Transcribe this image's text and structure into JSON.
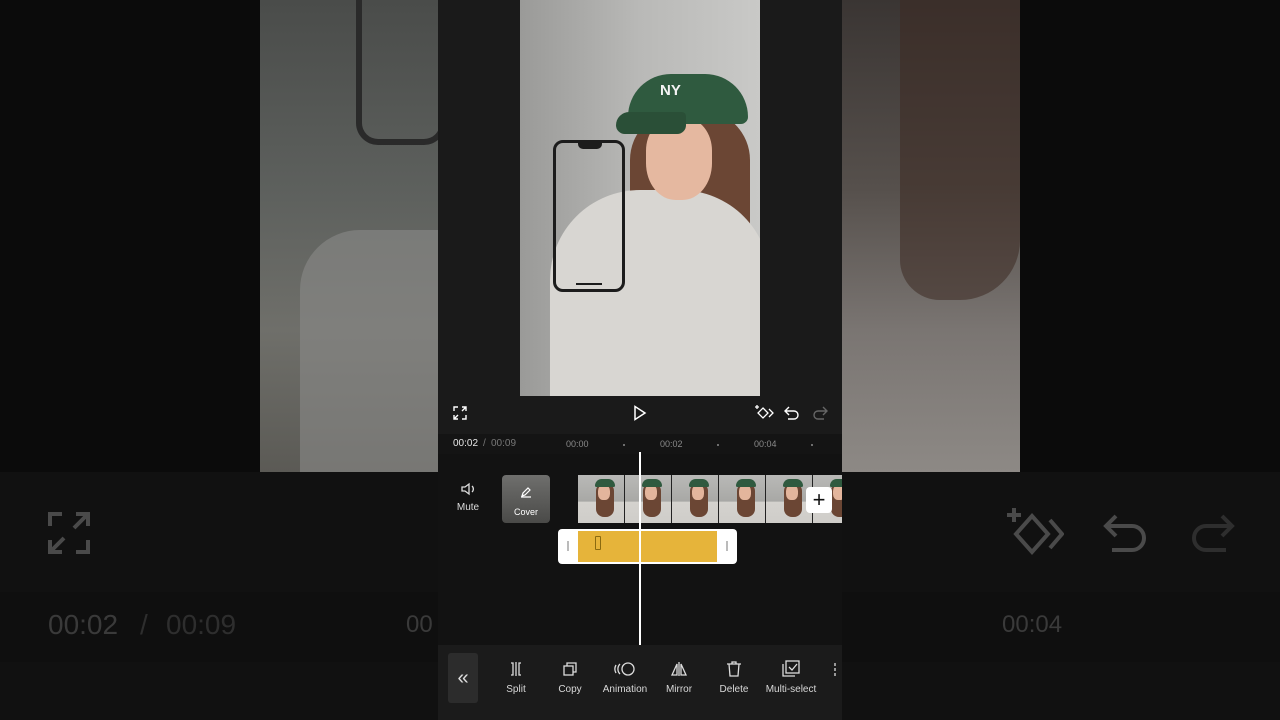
{
  "timeline": {
    "current_time": "00:02",
    "separator": "/",
    "total_time": "00:09",
    "ticks": [
      "00:00",
      "00:02",
      "00:04"
    ]
  },
  "track_labels": {
    "mute": "Mute",
    "cover": "Cover",
    "add": "+"
  },
  "preview": {
    "cap_logo": "NY"
  },
  "toolbar": {
    "back": "«",
    "items": [
      {
        "label": "Split",
        "icon": "split-icon"
      },
      {
        "label": "Copy",
        "icon": "copy-icon"
      },
      {
        "label": "Animation",
        "icon": "animation-icon"
      },
      {
        "label": "Mirror",
        "icon": "mirror-icon"
      },
      {
        "label": "Delete",
        "icon": "delete-icon"
      },
      {
        "label": "Multi-select",
        "icon": "multi-select-icon"
      }
    ]
  },
  "background_ghost": {
    "current_time": "00:02",
    "separator": "/",
    "total_time": "00:09",
    "tick_left": "00",
    "tick_right": "00:04"
  },
  "colors": {
    "accent_track": "#e6b43a",
    "panel": "#1b1b1b",
    "playhead": "#ffffff"
  }
}
